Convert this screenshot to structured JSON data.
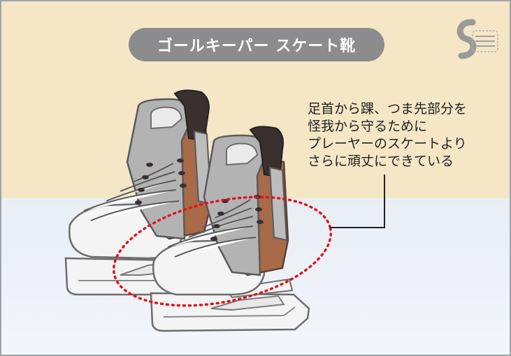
{
  "title": "ゴールキーパー スケート靴",
  "caption_lines": [
    "足首から踝、つま先部分を",
    "怪我から守るために",
    "プレーヤーのスケートより",
    "さらに頑丈にできている"
  ],
  "colors": {
    "background_top": "#f5e7c6",
    "background_bottom": "#eef2f7",
    "title_pill": "#8c8c8e",
    "boot_brown": "#a86a48",
    "boot_gray": "#b3b3b3",
    "boot_dark": "#3a3030",
    "blade": "#f2f2f2",
    "highlight_dotted": "#e0141e"
  }
}
